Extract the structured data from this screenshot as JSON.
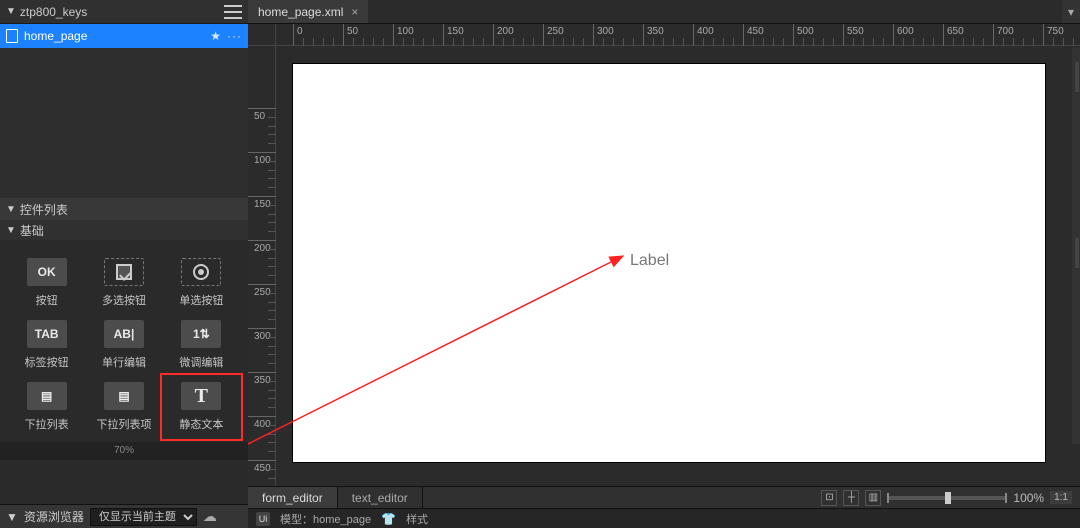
{
  "project": {
    "header": "ztp800_keys",
    "file": "home_page",
    "star": "★",
    "dots": "···"
  },
  "widgets_panel": {
    "title": "控件列表",
    "group": "基础",
    "items": [
      {
        "icon": "OK",
        "label": "按钮"
      },
      {
        "icon": "ck",
        "label": "多选按钮"
      },
      {
        "icon": "rad",
        "label": "单选按钮"
      },
      {
        "icon": "TAB",
        "label": "标签按钮"
      },
      {
        "icon": "AB|",
        "label": "单行编辑"
      },
      {
        "icon": "1⇅",
        "label": "微调编辑"
      },
      {
        "icon": "▤",
        "label": "下拉列表"
      },
      {
        "icon": "▤",
        "label": "下拉列表项"
      },
      {
        "icon": "T",
        "label": "静态文本",
        "highlight": true
      }
    ],
    "zoom_legend": "70%"
  },
  "resource_panel": {
    "title": "资源浏览器",
    "filter": "仅显示当前主题",
    "cloud_icon": "云"
  },
  "editor": {
    "tab_name": "home_page.xml",
    "tab_close": "×",
    "chevron": "▾",
    "canvas_label": "Label",
    "bottom_tabs": {
      "form": "form_editor",
      "text": "text_editor"
    },
    "zoom": {
      "pct": "100%",
      "ratio": "1:1"
    }
  },
  "status": {
    "ui_label": "Ui",
    "model_prefix": "模型：",
    "model_name": "home_page",
    "style_icon": "👕",
    "style_label": "样式"
  },
  "ruler_ticks": [
    0,
    50,
    100,
    150,
    200,
    250,
    300,
    350,
    400,
    450,
    500,
    550,
    600,
    650,
    700,
    750
  ],
  "ruler_ticks_v": [
    50,
    100,
    150,
    200,
    250,
    300,
    350,
    400,
    450
  ]
}
